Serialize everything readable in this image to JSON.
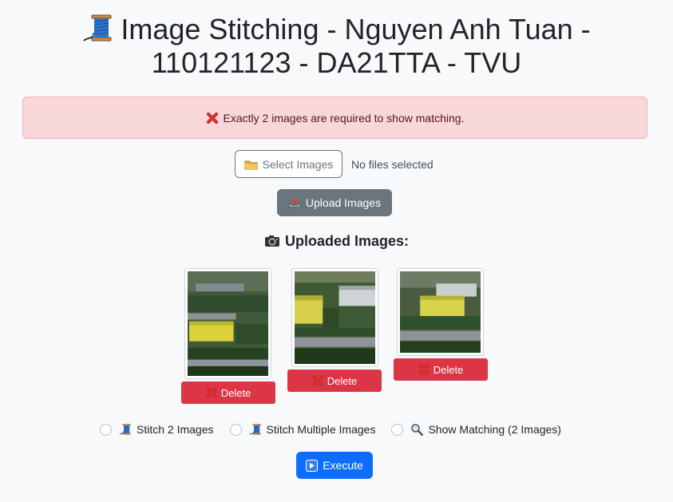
{
  "header": {
    "title": "Image Stitching - Nguyen Anh Tuan - 110121123 - DA21TTA - TVU",
    "icon": "thread-spool-icon"
  },
  "alert": {
    "message": "Exactly 2 images are required to show matching.",
    "icon": "cross-mark-icon",
    "background": "#f8d7da",
    "text_color": "#58151c"
  },
  "file_picker": {
    "button_label": "Select Images",
    "status": "No files selected",
    "icon": "folder-icon"
  },
  "upload": {
    "label": "Upload Images",
    "icon": "outbox-tray-icon"
  },
  "uploaded": {
    "heading": "Uploaded Images:",
    "icon": "camera-icon",
    "images": [
      {
        "delete_label": "Delete"
      },
      {
        "delete_label": "Delete"
      },
      {
        "delete_label": "Delete"
      }
    ]
  },
  "modes": {
    "options": [
      {
        "label": "Stitch 2 Images",
        "icon": "thread-spool-icon",
        "selected": false
      },
      {
        "label": "Stitch Multiple Images",
        "icon": "thread-spool-icon",
        "selected": false
      },
      {
        "label": "Show Matching (2 Images)",
        "icon": "magnifier-icon",
        "selected": false
      }
    ]
  },
  "execute": {
    "label": "Execute",
    "icon": "play-button-icon",
    "color": "#0d6efd"
  },
  "colors": {
    "danger": "#dc3545",
    "secondary": "#6c757d",
    "primary": "#0d6efd"
  }
}
